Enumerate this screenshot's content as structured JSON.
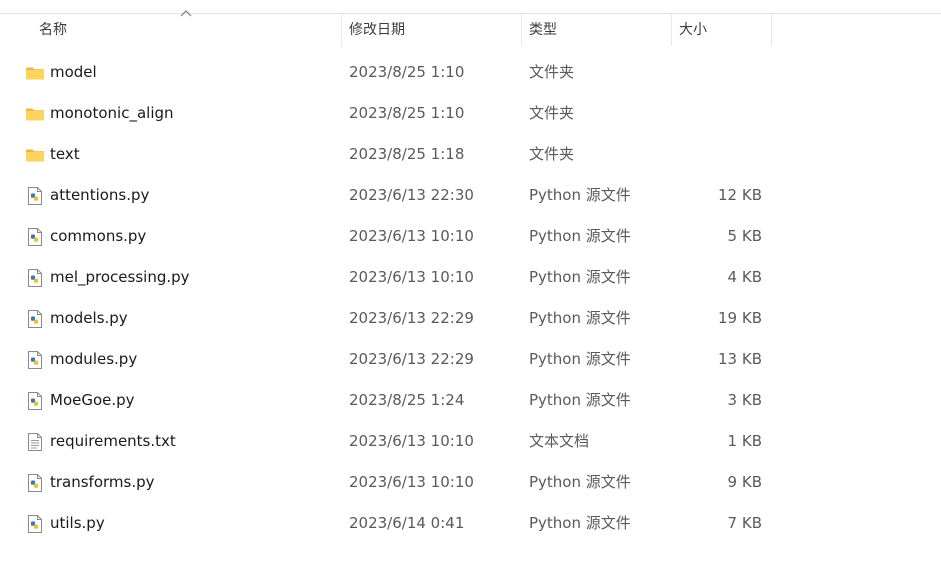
{
  "columns": {
    "name": "名称",
    "date": "修改日期",
    "type": "类型",
    "size": "大小"
  },
  "files": [
    {
      "icon": "folder-icon",
      "name": "model",
      "date": "2023/8/25 1:10",
      "type": "文件夹",
      "size": ""
    },
    {
      "icon": "folder-icon",
      "name": "monotonic_align",
      "date": "2023/8/25 1:10",
      "type": "文件夹",
      "size": ""
    },
    {
      "icon": "folder-icon",
      "name": "text",
      "date": "2023/8/25 1:18",
      "type": "文件夹",
      "size": ""
    },
    {
      "icon": "python-file-icon",
      "name": "attentions.py",
      "date": "2023/6/13 22:30",
      "type": "Python 源文件",
      "size": "12 KB"
    },
    {
      "icon": "python-file-icon",
      "name": "commons.py",
      "date": "2023/6/13 10:10",
      "type": "Python 源文件",
      "size": "5 KB"
    },
    {
      "icon": "python-file-icon",
      "name": "mel_processing.py",
      "date": "2023/6/13 10:10",
      "type": "Python 源文件",
      "size": "4 KB"
    },
    {
      "icon": "python-file-icon",
      "name": "models.py",
      "date": "2023/6/13 22:29",
      "type": "Python 源文件",
      "size": "19 KB"
    },
    {
      "icon": "python-file-icon",
      "name": "modules.py",
      "date": "2023/6/13 22:29",
      "type": "Python 源文件",
      "size": "13 KB"
    },
    {
      "icon": "python-file-icon",
      "name": "MoeGoe.py",
      "date": "2023/8/25 1:24",
      "type": "Python 源文件",
      "size": "3 KB"
    },
    {
      "icon": "text-file-icon",
      "name": "requirements.txt",
      "date": "2023/6/13 10:10",
      "type": "文本文档",
      "size": "1 KB"
    },
    {
      "icon": "python-file-icon",
      "name": "transforms.py",
      "date": "2023/6/13 10:10",
      "type": "Python 源文件",
      "size": "9 KB"
    },
    {
      "icon": "python-file-icon",
      "name": "utils.py",
      "date": "2023/6/14 0:41",
      "type": "Python 源文件",
      "size": "7 KB"
    }
  ]
}
